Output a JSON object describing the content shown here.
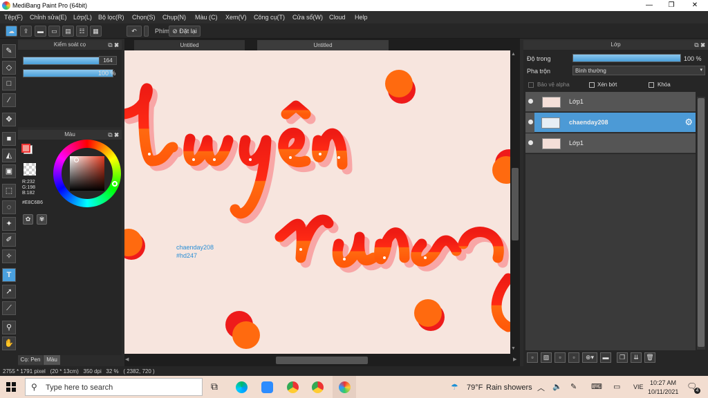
{
  "window": {
    "title": "MediBang Paint Pro (64bit)",
    "minimize": "—",
    "maximize": "❐",
    "close": "✕"
  },
  "menu": [
    "Tệp(F)",
    "Chỉnh sửa(E)",
    "Lớp(L)",
    "Bộ lọc(R)",
    "Chọn(S)",
    "Chụp(N)",
    "Màu (C)",
    "Xem(V)",
    "Công cụ(T)",
    "Cửa sổ(W)",
    "Cloud",
    "Help"
  ],
  "toolbar": {
    "undo_icon": "undo-arrow-icon",
    "keys_label": "Phím",
    "reset_label": "Đặt lại"
  },
  "brush_panel": {
    "title": "Kiểm soát cọ",
    "size_value": "164",
    "opacity_value": "100 %",
    "size_fraction": 0.9,
    "opacity_fraction": 1.0
  },
  "color_panel": {
    "title": "Màu",
    "r": "R:232",
    "g": "G:198",
    "b": "B:182",
    "hex": "#E8C6B6",
    "current_color": "#E8C6B6"
  },
  "bottom_tabs": {
    "pen": "Cọ: Pen",
    "color": "Màu"
  },
  "tabs": [
    "Untitled",
    "Untitled"
  ],
  "canvas": {
    "watermark_line1": "chaenday208",
    "watermark_line2": "#hd247",
    "background": "#f7e5de"
  },
  "layer_panel": {
    "title": "Lớp",
    "opacity_label": "Độ trong",
    "opacity_value": "100 %",
    "blend_label": "Pha trộn",
    "blend_value": "Bình thường",
    "protect_alpha": "Bảo vệ alpha",
    "clip": "Xén bớt",
    "lock": "Khóa",
    "layers": [
      {
        "name": "Lớp1",
        "selected": false
      },
      {
        "name": "chaenday208",
        "selected": true
      },
      {
        "name": "Lớp1",
        "selected": false
      }
    ]
  },
  "status": {
    "text": "2755 * 1791 pixel   (20 * 13cm)   350 dpi   32 %   ( 2382, 720 )"
  },
  "taskbar": {
    "search_placeholder": "Type here to search",
    "weather_temp": "79°F",
    "weather_text": "Rain showers",
    "lang": "VIE",
    "time": "10:27 AM",
    "date": "10/11/2021",
    "notifications": "4"
  }
}
